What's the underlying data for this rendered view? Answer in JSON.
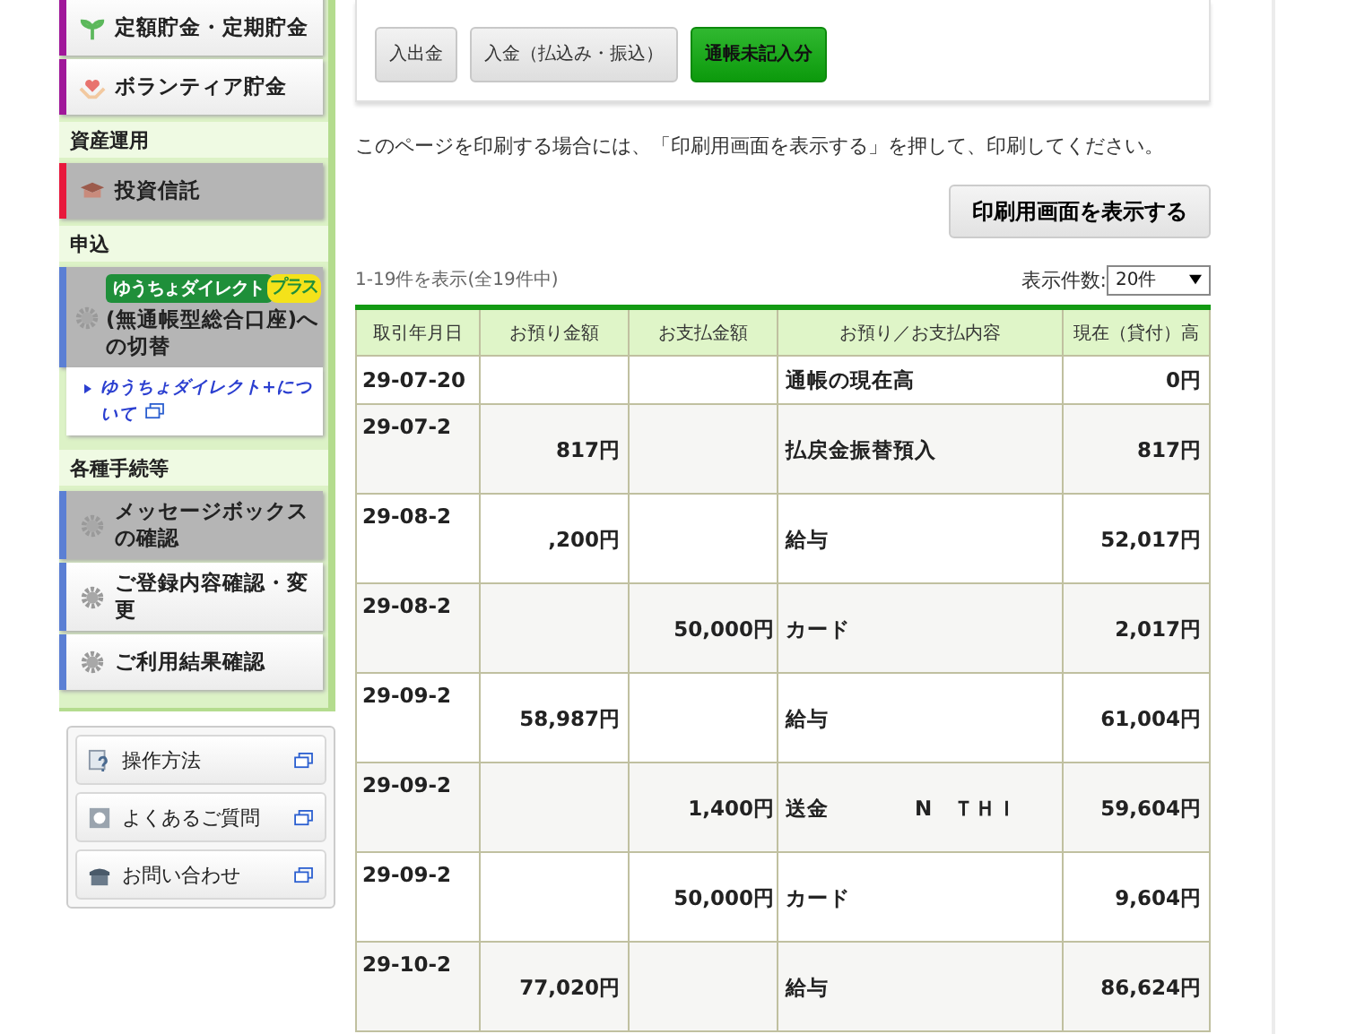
{
  "sidebar": {
    "items": [
      {
        "kind": "item",
        "label": "定額貯金・定期貯金",
        "color": "#a0179a",
        "highlighted": false
      },
      {
        "kind": "item",
        "label": "ボランティア貯金",
        "color": "#a0179a",
        "highlighted": false
      },
      {
        "kind": "heading",
        "label": "資産運用"
      },
      {
        "kind": "item",
        "label": "投資信託",
        "color": "#e8183c",
        "highlighted": true
      },
      {
        "kind": "heading",
        "label": "申込"
      },
      {
        "kind": "promo",
        "badge": "ゆうちょダイレクト",
        "badge_plus": "プラス",
        "label": "(無通帳型総合口座)への切替",
        "color": "#5b7fd4",
        "highlighted": true
      },
      {
        "kind": "link",
        "label": "ゆうちょダイレクト+について"
      },
      {
        "kind": "heading",
        "label": "各種手続等"
      },
      {
        "kind": "item",
        "label": "メッセージボックスの確認",
        "color": "#5b7fd4",
        "highlighted": true
      },
      {
        "kind": "item",
        "label": "ご登録内容確認・変更",
        "color": "#5b7fd4",
        "highlighted": false
      },
      {
        "kind": "item",
        "label": "ご利用結果確認",
        "color": "#5b7fd4",
        "highlighted": false
      }
    ],
    "help": [
      "操作方法",
      "よくあるご質問",
      "お問い合わせ"
    ]
  },
  "tabs": [
    {
      "label": "入出金",
      "selected": false
    },
    {
      "label": "入金（払込み・振込）",
      "selected": false
    },
    {
      "label": "通帳未記入分",
      "selected": true
    }
  ],
  "notice": "このページを印刷する場合には、「印刷用画面を表示する」を押して、印刷してください。",
  "print_button": "印刷用画面を表示する",
  "count_text": "1-19件を表示(全19件中)",
  "page_size": {
    "label": "表示件数:",
    "value": "20件"
  },
  "table": {
    "columns": [
      "取引年月日",
      "お預り金額",
      "お支払金額",
      "お預り／お支払内容",
      "現在（貸付）高"
    ],
    "rows": [
      [
        "29-07-20",
        "",
        "",
        "通帳の現在高",
        "0円"
      ],
      [
        "29-07-2",
        "817円",
        "",
        "払戻金振替預入",
        "817円"
      ],
      [
        "29-08-2",
        ",200円",
        "",
        "給与",
        "52,017円"
      ],
      [
        "29-08-2",
        "",
        "50,000円",
        "カード",
        "2,017円"
      ],
      [
        "29-09-2",
        "58,987円",
        "",
        "給与",
        "61,004円"
      ],
      [
        "29-09-2",
        "",
        "1,400円",
        "送金　　　　N　ＴＨＩ",
        "59,604円"
      ],
      [
        "29-09-2",
        "",
        "50,000円",
        "カード",
        "9,604円"
      ],
      [
        "29-10-2",
        "77,020円",
        "",
        "給与",
        "86,624円"
      ]
    ]
  }
}
